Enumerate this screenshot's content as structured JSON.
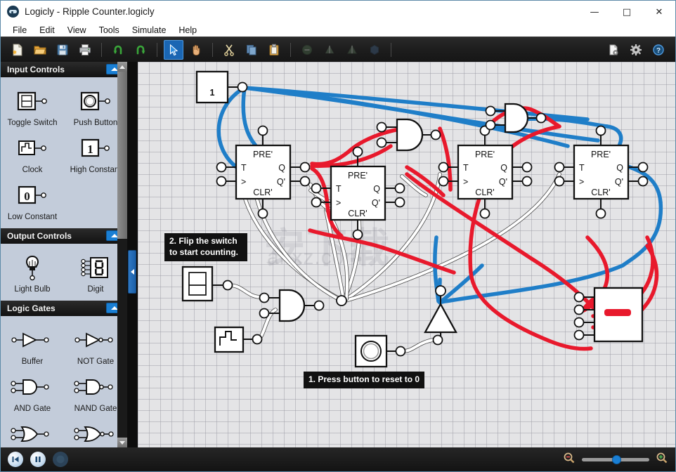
{
  "window": {
    "title": "Logicly - Ripple Counter.logicly",
    "logo_icon": "logicly-logo-icon",
    "controls": [
      {
        "name": "minimize-button",
        "glyph": "—"
      },
      {
        "name": "maximize-button",
        "glyph": "□"
      },
      {
        "name": "close-button",
        "glyph": "✕"
      }
    ]
  },
  "menubar": {
    "items": [
      {
        "label": "File"
      },
      {
        "label": "Edit"
      },
      {
        "label": "View"
      },
      {
        "label": "Tools"
      },
      {
        "label": "Simulate"
      },
      {
        "label": "Help"
      }
    ]
  },
  "toolbar": {
    "groups": [
      [
        {
          "name": "new-file-button",
          "icon": "new-document-icon",
          "enabled": true,
          "active": false
        },
        {
          "name": "open-file-button",
          "icon": "open-folder-icon",
          "enabled": true,
          "active": false
        },
        {
          "name": "save-file-button",
          "icon": "floppy-save-icon",
          "enabled": true,
          "active": false
        },
        {
          "name": "print-button",
          "icon": "printer-icon",
          "enabled": true,
          "active": false
        }
      ],
      [
        {
          "name": "undo-button",
          "icon": "undo-arrow-icon",
          "enabled": true,
          "active": false
        },
        {
          "name": "redo-button",
          "icon": "redo-arrow-icon",
          "enabled": true,
          "active": false
        }
      ],
      [
        {
          "name": "select-tool-button",
          "icon": "cursor-arrow-icon",
          "enabled": true,
          "active": true
        },
        {
          "name": "pan-tool-button",
          "icon": "hand-icon",
          "enabled": true,
          "active": false
        }
      ],
      [
        {
          "name": "cut-button",
          "icon": "scissors-icon",
          "enabled": true,
          "active": false
        },
        {
          "name": "copy-button",
          "icon": "copy-pages-icon",
          "enabled": true,
          "active": false
        },
        {
          "name": "paste-button",
          "icon": "clipboard-icon",
          "enabled": true,
          "active": false
        }
      ],
      [
        {
          "name": "zoom-fit-button",
          "icon": "circle-minus-icon",
          "enabled": false,
          "active": false
        },
        {
          "name": "align-left-button",
          "icon": "align-left-icon",
          "enabled": false,
          "active": false
        },
        {
          "name": "align-right-button",
          "icon": "align-right-icon",
          "enabled": false,
          "active": false
        },
        {
          "name": "shape-button",
          "icon": "hexagon-icon",
          "enabled": false,
          "active": false
        }
      ]
    ],
    "right": [
      {
        "name": "document-properties-button",
        "icon": "document-gear-icon"
      },
      {
        "name": "settings-button",
        "icon": "gear-icon"
      },
      {
        "name": "help-button",
        "icon": "question-help-icon"
      }
    ]
  },
  "sidebar": {
    "sections": [
      {
        "title": "Input Controls",
        "collapse_icon": "chevron-up-icon",
        "items": [
          {
            "label": "Toggle Switch",
            "icon": "toggle-switch-icon"
          },
          {
            "label": "Push Button",
            "icon": "push-button-icon"
          },
          {
            "label": "Clock",
            "icon": "clock-waveform-icon"
          },
          {
            "label": "High Constant",
            "icon": "high-constant-one-icon"
          },
          {
            "label": "Low Constant",
            "icon": "low-constant-zero-icon"
          }
        ]
      },
      {
        "title": "Output Controls",
        "collapse_icon": "chevron-up-icon",
        "items": [
          {
            "label": "Light Bulb",
            "icon": "light-bulb-icon"
          },
          {
            "label": "Digit",
            "icon": "seven-segment-digit-icon"
          }
        ]
      },
      {
        "title": "Logic Gates",
        "collapse_icon": "chevron-up-icon",
        "items": [
          {
            "label": "Buffer",
            "icon": "buffer-gate-icon"
          },
          {
            "label": "NOT Gate",
            "icon": "not-gate-icon"
          },
          {
            "label": "AND Gate",
            "icon": "and-gate-icon"
          },
          {
            "label": "NAND Gate",
            "icon": "nand-gate-icon"
          },
          {
            "label": "",
            "icon": "or-gate-icon"
          },
          {
            "label": "",
            "icon": "nor-gate-icon"
          }
        ]
      }
    ],
    "scrollbar": {
      "up_icon": "scroll-up-arrow-icon",
      "down_icon": "scroll-down-arrow-icon"
    }
  },
  "canvas": {
    "collapse_handle_icon": "chevron-left-icon",
    "watermark": "安下载",
    "watermark_sub": "anxz.com",
    "annotations": [
      {
        "name": "annotation-flip-switch",
        "line1": "2. Flip the switch",
        "line2": "to start counting."
      },
      {
        "name": "annotation-reset-button",
        "line1": "1. Press button to reset to 0",
        "line2": ""
      }
    ],
    "high_constant_value": "1",
    "flipflops": [
      {
        "name": "flipflop-1",
        "pre": "PRE'",
        "t": "T",
        "clk": ">",
        "clr": "CLR'",
        "q": "Q",
        "qn": "Q'"
      },
      {
        "name": "flipflop-2",
        "pre": "PRE'",
        "t": "T",
        "clk": ">",
        "clr": "CLR'",
        "q": "Q",
        "qn": "Q'"
      },
      {
        "name": "flipflop-3",
        "pre": "PRE'",
        "t": "T",
        "clk": ">",
        "clr": "CLR'",
        "q": "Q",
        "qn": "Q'"
      },
      {
        "name": "flipflop-4",
        "pre": "PRE'",
        "t": "T",
        "clk": ">",
        "clr": "CLR'",
        "q": "Q",
        "qn": "Q'"
      }
    ],
    "colors": {
      "wire_high": "#e8192c",
      "wire_blue": "#1f7ec8",
      "wire_low": "#ffffff",
      "grid": "#e4e4e6",
      "constant_text": "#1f7ec8",
      "digit_segment": "#e8192c"
    }
  },
  "statusbar": {
    "buttons": [
      {
        "name": "restart-simulation-button",
        "icon": "skip-back-icon",
        "state": "enabled"
      },
      {
        "name": "pause-simulation-button",
        "icon": "pause-icon",
        "state": "enabled"
      },
      {
        "name": "step-simulation-button",
        "icon": "step-dot-icon",
        "state": "disabled"
      }
    ],
    "zoom": {
      "out_icon": "zoom-out-icon",
      "in_icon": "zoom-in-icon",
      "value": 50
    }
  }
}
